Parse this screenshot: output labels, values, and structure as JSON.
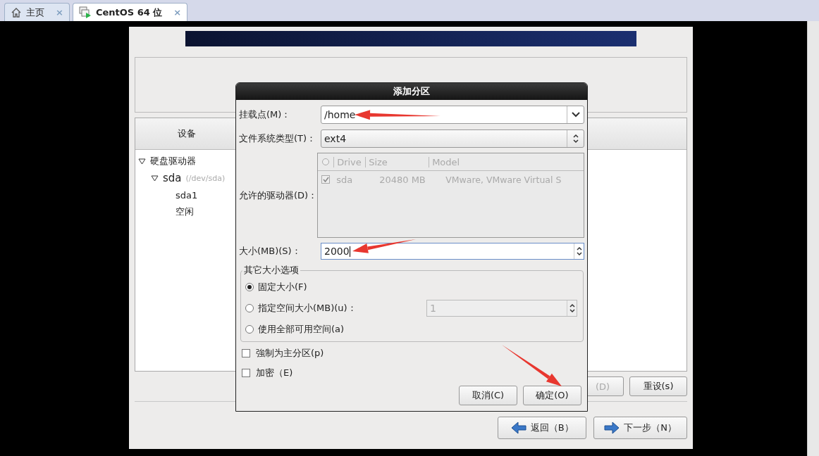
{
  "browser_tabs": [
    {
      "label": "主页",
      "kind": "home",
      "selected": false,
      "close": "×"
    },
    {
      "label": "CentOS 64 位",
      "kind": "vm",
      "selected": true,
      "close": "×"
    }
  ],
  "installer": {
    "columns": [
      "设备"
    ],
    "tree": [
      {
        "label": "硬盘驱动器",
        "expanded": true,
        "children": [
          {
            "label": "sda",
            "note": "(/dev/sda)",
            "expanded": true,
            "children": [
              {
                "label": "sda1"
              },
              {
                "label": "空闲"
              }
            ]
          }
        ]
      }
    ],
    "buttons": [
      {
        "label": "(D)",
        "disabled": true
      },
      {
        "label": "重设(s)",
        "disabled": false
      }
    ],
    "nav_buttons": [
      {
        "label": "返回（B）",
        "kind": "back"
      },
      {
        "label": "下一步（N）",
        "kind": "next"
      }
    ]
  },
  "dialog": {
    "title": "添加分区",
    "mount_point": {
      "label": "挂载点(M)：",
      "value": "/home"
    },
    "fs_type": {
      "label": "文件系统类型(T)：",
      "value": "ext4"
    },
    "drives": {
      "label": "允许的驱动器(D)：",
      "columns": [
        "Drive",
        "Size",
        "Model"
      ],
      "rows": [
        {
          "drive": "sda",
          "size": "20480 MB",
          "model": "VMware, VMware Virtual S",
          "checked": true
        }
      ]
    },
    "size": {
      "label": "大小(MB)(S)：",
      "value": "2000"
    },
    "size_options": {
      "title": "其它大小选项",
      "options": [
        {
          "label": "固定大小(F)",
          "selected": true
        },
        {
          "label": "指定空间大小(MB)(u)：",
          "selected": false,
          "value": "1",
          "disabled": true
        },
        {
          "label": "使用全部可用空间(a)",
          "selected": false
        }
      ]
    },
    "checkboxes": [
      {
        "label": "強制为主分区(p)",
        "checked": false
      },
      {
        "label": "加密（E)",
        "checked": false
      }
    ],
    "buttons": [
      {
        "label": "取消(C)"
      },
      {
        "label": "确定(O)"
      }
    ]
  }
}
